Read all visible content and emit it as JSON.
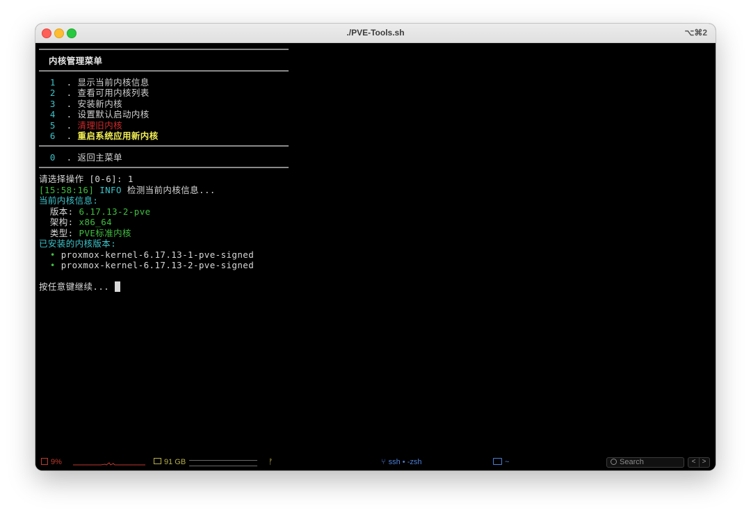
{
  "window": {
    "title": "./PVE-Tools.sh",
    "shortcut": "⌥⌘2"
  },
  "menu": {
    "header": "内核管理菜单",
    "items": [
      {
        "num": "1",
        "label": "显示当前内核信息",
        "style": "normal"
      },
      {
        "num": "2",
        "label": "查看可用内核列表",
        "style": "normal"
      },
      {
        "num": "3",
        "label": "安装新内核",
        "style": "normal"
      },
      {
        "num": "4",
        "label": "设置默认启动内核",
        "style": "normal"
      },
      {
        "num": "5",
        "label": "清理旧内核",
        "style": "danger"
      },
      {
        "num": "6",
        "label": "重启系统应用新内核",
        "style": "highlight"
      }
    ],
    "back": {
      "num": "0",
      "label": "返回主菜单"
    }
  },
  "output": {
    "prompt": "请选择操作 [0-6]: ",
    "choice": "1",
    "log_time": "[15:58:16]",
    "log_level": "INFO",
    "log_msg": " 检测当前内核信息...",
    "current_header": "当前内核信息:",
    "version_label": "  版本:",
    "version_value": "6.17.13-2-pve",
    "arch_label": "  架构:",
    "arch_value": "x86_64",
    "type_label": "  类型:",
    "type_value": "PVE标准内核",
    "installed_header": "已安装的内核版本:",
    "installed": [
      "proxmox-kernel-6.17.13-1-pve-signed",
      "proxmox-kernel-6.17.13-2-pve-signed"
    ],
    "bullet": "•",
    "continue": "按任意键继续... "
  },
  "statusbar": {
    "cpu": "9%",
    "memory": "91 GB",
    "session": "ssh • -zsh",
    "folder": "~",
    "search_placeholder": "Search",
    "nav_prev": "<",
    "nav_next": ">"
  },
  "colors": {
    "cyan": "#3cc3c9",
    "green": "#3fbf3f",
    "red": "#d22b2b",
    "yellow": "#f2ee55",
    "cpu_red": "#c0392b",
    "mem_yellow": "#b7b04a",
    "session_blue": "#4a7fd6"
  }
}
